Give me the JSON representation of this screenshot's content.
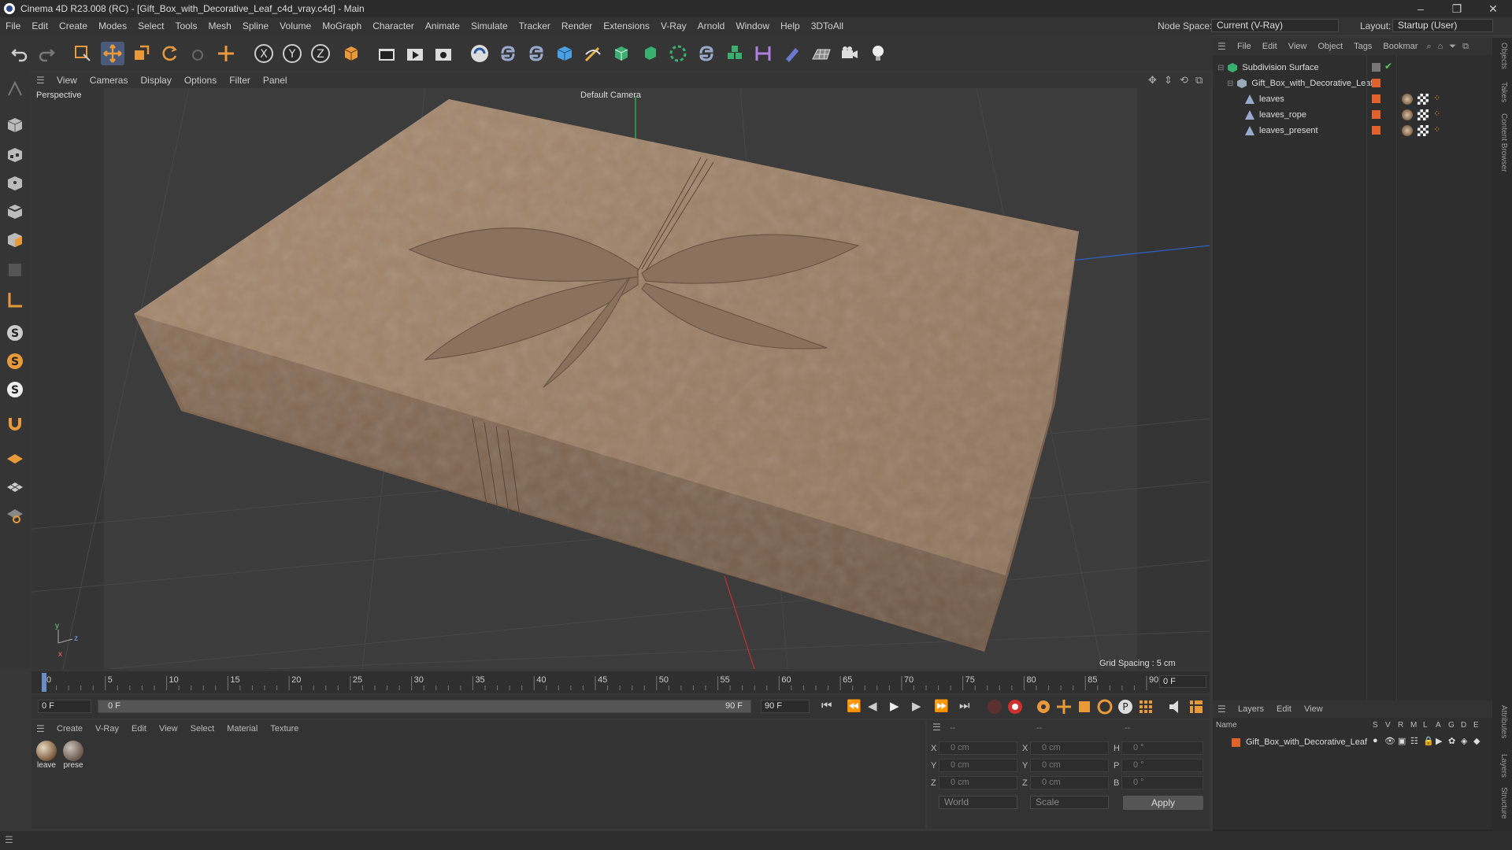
{
  "window": {
    "title": "Cinema 4D R23.008 (RC) - [Gift_Box_with_Decorative_Leaf_c4d_vray.c4d] - Main",
    "controls": [
      "–",
      "❐",
      "✕"
    ]
  },
  "menu": [
    "File",
    "Edit",
    "Create",
    "Modes",
    "Select",
    "Tools",
    "Mesh",
    "Spline",
    "Volume",
    "MoGraph",
    "Character",
    "Animate",
    "Simulate",
    "Tracker",
    "Render",
    "Extensions",
    "V-Ray",
    "Arnold",
    "Window",
    "Help",
    "3DToAll"
  ],
  "nodespace": {
    "label": "Node Space:",
    "value": "Current (V-Ray)"
  },
  "layout": {
    "label": "Layout:",
    "value": "Startup (User)"
  },
  "viewport": {
    "menu": [
      "View",
      "Cameras",
      "Display",
      "Options",
      "Filter",
      "Panel"
    ],
    "name": "Perspective",
    "camera": "Default Camera",
    "grid": "Grid Spacing : 5 cm",
    "axes": {
      "y": "y",
      "z": "z",
      "x": "x"
    }
  },
  "timeline": {
    "ticks": [
      "0",
      "5",
      "10",
      "15",
      "20",
      "25",
      "30",
      "35",
      "40",
      "45",
      "50",
      "55",
      "60",
      "65",
      "70",
      "75",
      "80",
      "85",
      "90"
    ],
    "current": "0 F"
  },
  "playbar": {
    "start": "0 F",
    "range_start": "0 F",
    "range_end": "90 F",
    "end": "90 F"
  },
  "materials": {
    "menu": [
      "Create",
      "V-Ray",
      "Edit",
      "View",
      "Select",
      "Material",
      "Texture"
    ],
    "items": [
      {
        "label": "leave"
      },
      {
        "label": "prese"
      }
    ]
  },
  "coords": {
    "dash1": "--",
    "dash2": "--",
    "dash3": "--",
    "rows": [
      {
        "a": "X",
        "v1": "0 cm",
        "b": "X",
        "v2": "0 cm",
        "c": "H",
        "v3": "0 °"
      },
      {
        "a": "Y",
        "v1": "0 cm",
        "b": "Y",
        "v2": "0 cm",
        "c": "P",
        "v3": "0 °"
      },
      {
        "a": "Z",
        "v1": "0 cm",
        "b": "Z",
        "v2": "0 cm",
        "c": "B",
        "v3": "0 °"
      }
    ],
    "world": "World",
    "scale": "Scale",
    "apply": "Apply"
  },
  "objects": {
    "menu": [
      "File",
      "Edit",
      "View",
      "Object",
      "Tags",
      "Bookmar"
    ],
    "rows": [
      {
        "name": "Subdivision Surface"
      },
      {
        "name": "Gift_Box_with_Decorative_Leaf"
      },
      {
        "name": "leaves"
      },
      {
        "name": "leaves_rope"
      },
      {
        "name": "leaves_present"
      }
    ]
  },
  "layers": {
    "menu": [
      "Layers",
      "Edit",
      "View"
    ],
    "header": {
      "name": "Name",
      "cols": [
        "S",
        "V",
        "R",
        "M",
        "L",
        "A",
        "G",
        "D",
        "E"
      ]
    },
    "rows": [
      {
        "name": "Gift_Box_with_Decorative_Leaf"
      }
    ]
  },
  "side_tabs": {
    "top": [
      "Objects",
      "Takes",
      "Content Browser"
    ],
    "bottom": [
      "Attributes",
      "Layers",
      "Structure"
    ]
  },
  "colors": {
    "accent": "#e0622a",
    "box": "#9a7f66",
    "bg": "#383838"
  }
}
